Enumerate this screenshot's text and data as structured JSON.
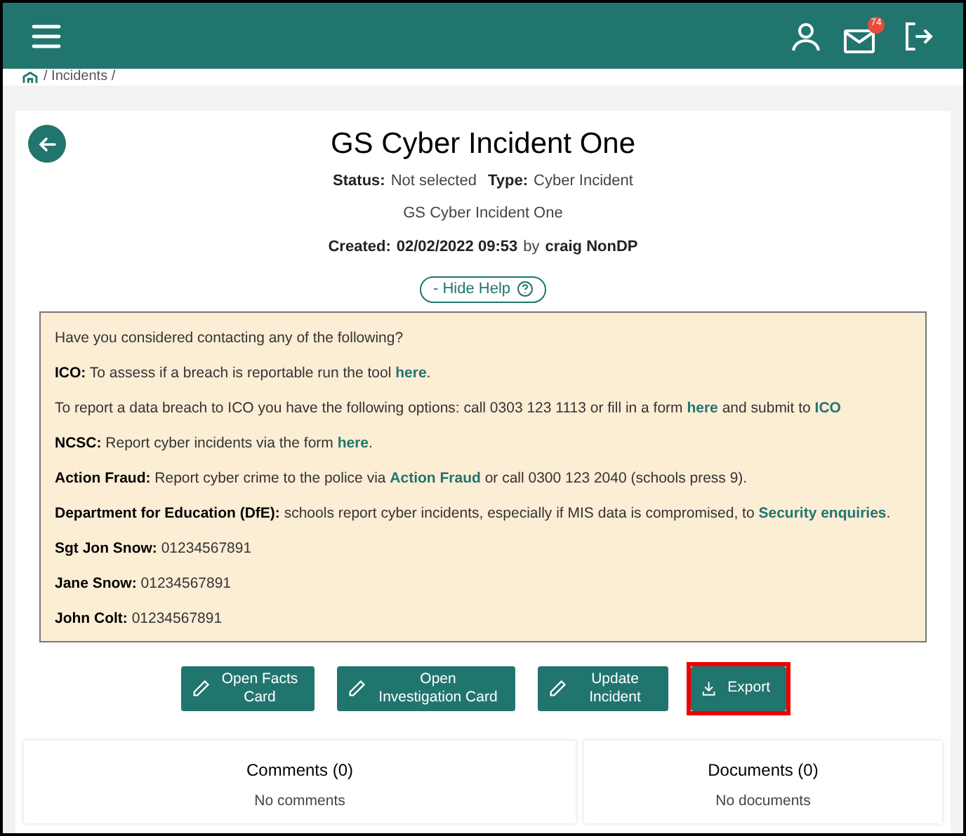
{
  "header": {
    "notification_count": "74"
  },
  "breadcrumb": [
    "/ Incidents /"
  ],
  "incident": {
    "title": "GS Cyber Incident One",
    "status_label": "Status:",
    "status": "Not selected",
    "type_label": "Type:",
    "type": "Cyber Incident",
    "description": "GS Cyber Incident One",
    "created_label": "Created:",
    "created": "02/02/2022 09:53",
    "by": "by",
    "author": "craig NonDP"
  },
  "help_toggle": "- Hide Help",
  "help_lines": [
    [
      {
        "kind": "plain",
        "text": "Have you considered contacting any of the following?"
      }
    ],
    [
      {
        "kind": "bold",
        "text": "ICO:"
      },
      {
        "kind": "plain",
        "text": " To assess if a breach is reportable run the tool "
      },
      {
        "kind": "link",
        "text": "here"
      },
      {
        "kind": "plain",
        "text": "."
      }
    ],
    [
      {
        "kind": "plain",
        "text": "To report a data breach to ICO you have the following options: call 0303 123 1113 or fill in a form "
      },
      {
        "kind": "link",
        "text": "here"
      },
      {
        "kind": "plain",
        "text": " and submit to "
      },
      {
        "kind": "link",
        "text": "ICO"
      }
    ],
    [
      {
        "kind": "bold",
        "text": "NCSC:"
      },
      {
        "kind": "plain",
        "text": " Report cyber incidents via the form "
      },
      {
        "kind": "link",
        "text": "here"
      },
      {
        "kind": "plain",
        "text": "."
      }
    ],
    [
      {
        "kind": "bold",
        "text": "Action Fraud:"
      },
      {
        "kind": "plain",
        "text": " Report cyber crime to the police via "
      },
      {
        "kind": "link",
        "text": "Action Fraud"
      },
      {
        "kind": "plain",
        "text": " or call 0300 123 2040 (schools press 9)."
      }
    ],
    [
      {
        "kind": "bold",
        "text": "Department for Education (DfE):"
      },
      {
        "kind": "plain",
        "text": " schools report cyber incidents, especially if MIS data is compromised, to "
      },
      {
        "kind": "link",
        "text": "Security enquiries"
      },
      {
        "kind": "plain",
        "text": "."
      }
    ],
    [
      {
        "kind": "bold",
        "text": "Sgt Jon Snow:"
      },
      {
        "kind": "plain",
        "text": " 01234567891"
      }
    ],
    [
      {
        "kind": "bold",
        "text": "Jane Snow:"
      },
      {
        "kind": "plain",
        "text": " 01234567891"
      }
    ],
    [
      {
        "kind": "bold",
        "text": "John Colt:"
      },
      {
        "kind": "plain",
        "text": " 01234567891"
      }
    ]
  ],
  "actions": [
    {
      "kind": "edit",
      "label": "Open Facts Card",
      "highlighted": false
    },
    {
      "kind": "edit",
      "label": "Open Investigation Card",
      "highlighted": false
    },
    {
      "kind": "edit",
      "label": "Update Incident",
      "highlighted": false
    },
    {
      "kind": "export",
      "label": "Export",
      "highlighted": true
    }
  ],
  "panels": [
    {
      "title": "Comments (0)",
      "empty_text": "No comments"
    },
    {
      "title": "Documents (0)",
      "empty_text": "No documents"
    }
  ]
}
